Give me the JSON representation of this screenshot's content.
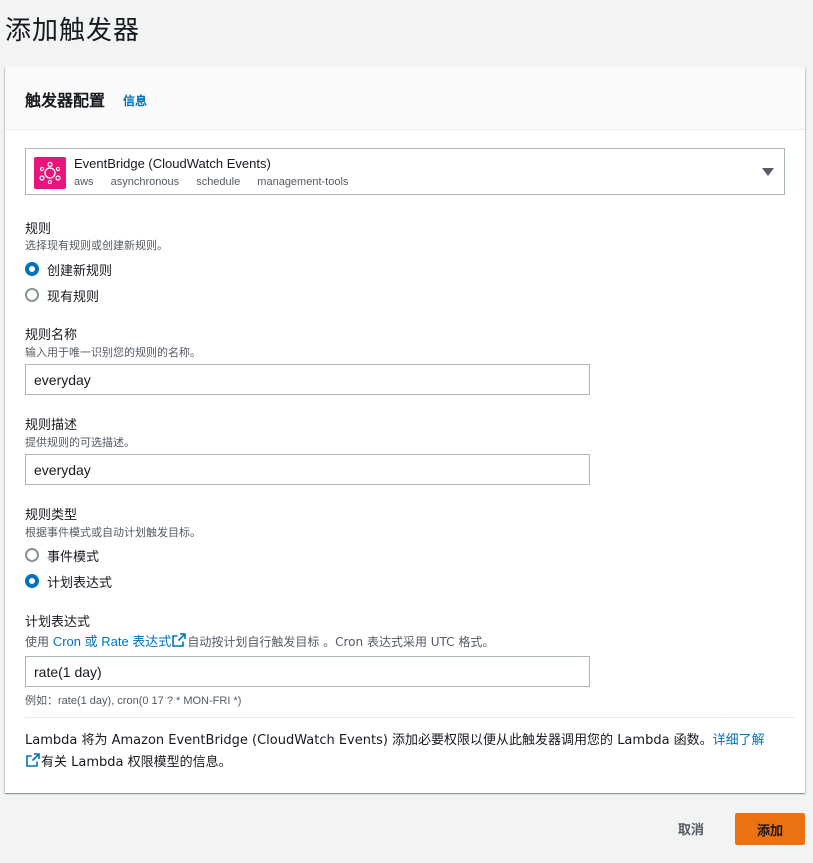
{
  "page": {
    "title": "添加触发器"
  },
  "panel": {
    "title": "触发器配置",
    "info_link": "信息"
  },
  "source": {
    "name": "EventBridge (CloudWatch Events)",
    "tags": [
      "aws",
      "asynchronous",
      "schedule",
      "management-tools"
    ],
    "icon": "eventbridge-icon"
  },
  "rule": {
    "label": "规则",
    "description": "选择现有规则或创建新规则。",
    "options": [
      {
        "label": "创建新规则",
        "checked": true
      },
      {
        "label": "现有规则",
        "checked": false
      }
    ]
  },
  "rule_name": {
    "label": "规则名称",
    "description": "输入用于唯一识别您的规则的名称。",
    "value": "everyday"
  },
  "rule_description": {
    "label": "规则描述",
    "description": "提供规则的可选描述。",
    "value": "everyday"
  },
  "rule_type": {
    "label": "规则类型",
    "description": "根据事件模式或自动计划触发目标。",
    "options": [
      {
        "label": "事件模式",
        "checked": false
      },
      {
        "label": "计划表达式",
        "checked": true
      }
    ]
  },
  "schedule": {
    "label": "计划表达式",
    "desc_prefix": "使用 ",
    "desc_link": "Cron 或 Rate 表达式",
    "desc_suffix": "自动按计划自行触发目标 。Cron 表达式采用 UTC 格式。",
    "value": "rate(1 day)",
    "example": "例如：rate(1 day), cron(0 17 ? * MON-FRI *)"
  },
  "footer": {
    "text": "Lambda 将为 Amazon EventBridge (CloudWatch Events) 添加必要权限以便从此触发器调用您的 Lambda 函数。",
    "link": "详细了解",
    "suffix": "有关 Lambda 权限模型的信息。"
  },
  "actions": {
    "cancel": "取消",
    "add": "添加"
  },
  "colors": {
    "accent": "#0073bb",
    "primary_button": "#ec7211",
    "source_icon_bg": "#e7157b"
  }
}
